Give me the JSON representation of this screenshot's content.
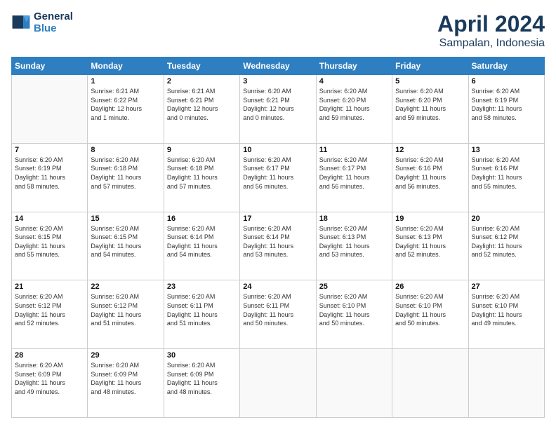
{
  "header": {
    "logo_line1": "General",
    "logo_line2": "Blue",
    "month": "April 2024",
    "location": "Sampalan, Indonesia"
  },
  "weekdays": [
    "Sunday",
    "Monday",
    "Tuesday",
    "Wednesday",
    "Thursday",
    "Friday",
    "Saturday"
  ],
  "weeks": [
    [
      {
        "day": "",
        "info": ""
      },
      {
        "day": "1",
        "info": "Sunrise: 6:21 AM\nSunset: 6:22 PM\nDaylight: 12 hours\nand 1 minute."
      },
      {
        "day": "2",
        "info": "Sunrise: 6:21 AM\nSunset: 6:21 PM\nDaylight: 12 hours\nand 0 minutes."
      },
      {
        "day": "3",
        "info": "Sunrise: 6:20 AM\nSunset: 6:21 PM\nDaylight: 12 hours\nand 0 minutes."
      },
      {
        "day": "4",
        "info": "Sunrise: 6:20 AM\nSunset: 6:20 PM\nDaylight: 11 hours\nand 59 minutes."
      },
      {
        "day": "5",
        "info": "Sunrise: 6:20 AM\nSunset: 6:20 PM\nDaylight: 11 hours\nand 59 minutes."
      },
      {
        "day": "6",
        "info": "Sunrise: 6:20 AM\nSunset: 6:19 PM\nDaylight: 11 hours\nand 58 minutes."
      }
    ],
    [
      {
        "day": "7",
        "info": "Sunrise: 6:20 AM\nSunset: 6:19 PM\nDaylight: 11 hours\nand 58 minutes."
      },
      {
        "day": "8",
        "info": "Sunrise: 6:20 AM\nSunset: 6:18 PM\nDaylight: 11 hours\nand 57 minutes."
      },
      {
        "day": "9",
        "info": "Sunrise: 6:20 AM\nSunset: 6:18 PM\nDaylight: 11 hours\nand 57 minutes."
      },
      {
        "day": "10",
        "info": "Sunrise: 6:20 AM\nSunset: 6:17 PM\nDaylight: 11 hours\nand 56 minutes."
      },
      {
        "day": "11",
        "info": "Sunrise: 6:20 AM\nSunset: 6:17 PM\nDaylight: 11 hours\nand 56 minutes."
      },
      {
        "day": "12",
        "info": "Sunrise: 6:20 AM\nSunset: 6:16 PM\nDaylight: 11 hours\nand 56 minutes."
      },
      {
        "day": "13",
        "info": "Sunrise: 6:20 AM\nSunset: 6:16 PM\nDaylight: 11 hours\nand 55 minutes."
      }
    ],
    [
      {
        "day": "14",
        "info": "Sunrise: 6:20 AM\nSunset: 6:15 PM\nDaylight: 11 hours\nand 55 minutes."
      },
      {
        "day": "15",
        "info": "Sunrise: 6:20 AM\nSunset: 6:15 PM\nDaylight: 11 hours\nand 54 minutes."
      },
      {
        "day": "16",
        "info": "Sunrise: 6:20 AM\nSunset: 6:14 PM\nDaylight: 11 hours\nand 54 minutes."
      },
      {
        "day": "17",
        "info": "Sunrise: 6:20 AM\nSunset: 6:14 PM\nDaylight: 11 hours\nand 53 minutes."
      },
      {
        "day": "18",
        "info": "Sunrise: 6:20 AM\nSunset: 6:13 PM\nDaylight: 11 hours\nand 53 minutes."
      },
      {
        "day": "19",
        "info": "Sunrise: 6:20 AM\nSunset: 6:13 PM\nDaylight: 11 hours\nand 52 minutes."
      },
      {
        "day": "20",
        "info": "Sunrise: 6:20 AM\nSunset: 6:12 PM\nDaylight: 11 hours\nand 52 minutes."
      }
    ],
    [
      {
        "day": "21",
        "info": "Sunrise: 6:20 AM\nSunset: 6:12 PM\nDaylight: 11 hours\nand 52 minutes."
      },
      {
        "day": "22",
        "info": "Sunrise: 6:20 AM\nSunset: 6:12 PM\nDaylight: 11 hours\nand 51 minutes."
      },
      {
        "day": "23",
        "info": "Sunrise: 6:20 AM\nSunset: 6:11 PM\nDaylight: 11 hours\nand 51 minutes."
      },
      {
        "day": "24",
        "info": "Sunrise: 6:20 AM\nSunset: 6:11 PM\nDaylight: 11 hours\nand 50 minutes."
      },
      {
        "day": "25",
        "info": "Sunrise: 6:20 AM\nSunset: 6:10 PM\nDaylight: 11 hours\nand 50 minutes."
      },
      {
        "day": "26",
        "info": "Sunrise: 6:20 AM\nSunset: 6:10 PM\nDaylight: 11 hours\nand 50 minutes."
      },
      {
        "day": "27",
        "info": "Sunrise: 6:20 AM\nSunset: 6:10 PM\nDaylight: 11 hours\nand 49 minutes."
      }
    ],
    [
      {
        "day": "28",
        "info": "Sunrise: 6:20 AM\nSunset: 6:09 PM\nDaylight: 11 hours\nand 49 minutes."
      },
      {
        "day": "29",
        "info": "Sunrise: 6:20 AM\nSunset: 6:09 PM\nDaylight: 11 hours\nand 48 minutes."
      },
      {
        "day": "30",
        "info": "Sunrise: 6:20 AM\nSunset: 6:09 PM\nDaylight: 11 hours\nand 48 minutes."
      },
      {
        "day": "",
        "info": ""
      },
      {
        "day": "",
        "info": ""
      },
      {
        "day": "",
        "info": ""
      },
      {
        "day": "",
        "info": ""
      }
    ]
  ]
}
